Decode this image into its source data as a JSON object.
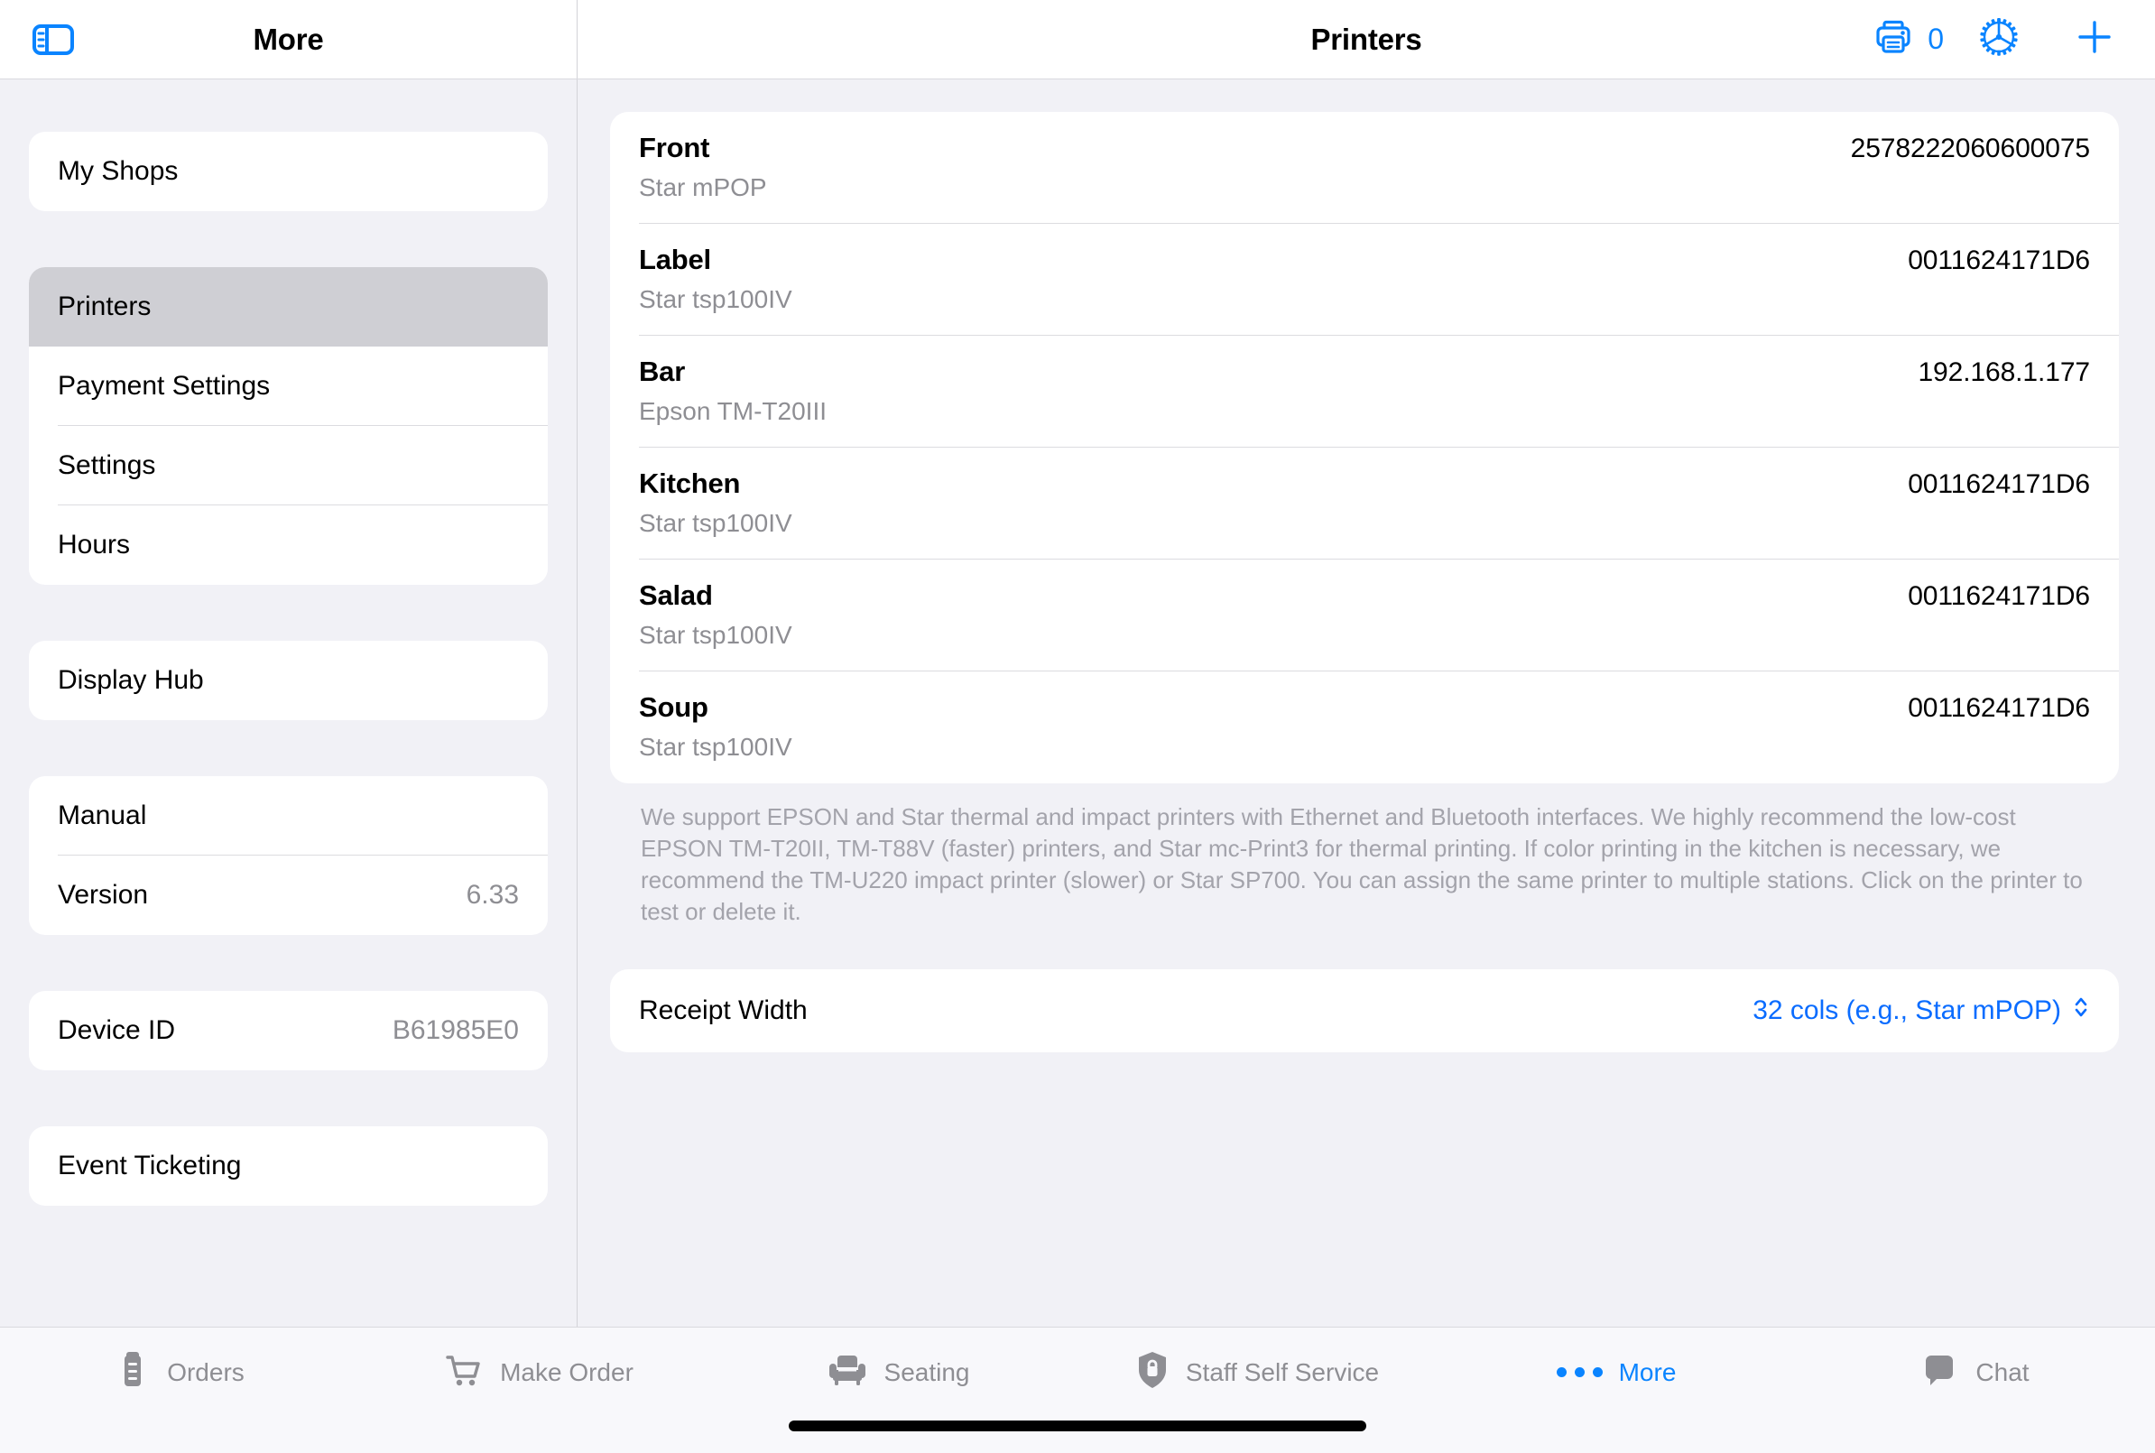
{
  "topbar": {
    "sidebar_toggle_icon": "sidebar-icon",
    "left_title": "More",
    "right_title": "Printers",
    "print_queue_icon": "printer-icon",
    "print_queue_count": "0",
    "settings_icon": "gear-icon",
    "add_icon": "plus-icon",
    "accent_color": "#0a84ff"
  },
  "sidebar": {
    "group1": [
      {
        "label": "My Shops",
        "value": "",
        "selected": false
      }
    ],
    "group2": [
      {
        "label": "Printers",
        "value": "",
        "selected": true
      },
      {
        "label": "Payment Settings",
        "value": "",
        "selected": false
      },
      {
        "label": "Settings",
        "value": "",
        "selected": false
      },
      {
        "label": "Hours",
        "value": "",
        "selected": false
      }
    ],
    "group3": [
      {
        "label": "Display Hub",
        "value": "",
        "selected": false
      }
    ],
    "group4": [
      {
        "label": "Manual",
        "value": "",
        "selected": false
      },
      {
        "label": "Version",
        "value": "6.33",
        "selected": false
      }
    ],
    "group5": [
      {
        "label": "Device ID",
        "value": "B61985E0",
        "selected": false
      }
    ],
    "group6": [
      {
        "label": "Event Ticketing",
        "value": "",
        "selected": false
      }
    ]
  },
  "main": {
    "printers": [
      {
        "name": "Front",
        "id": "2578222060600075",
        "model": "Star mPOP"
      },
      {
        "name": "Label",
        "id": "0011624171D6",
        "model": "Star tsp100IV"
      },
      {
        "name": "Bar",
        "id": "192.168.1.177",
        "model": "Epson TM-T20III"
      },
      {
        "name": "Kitchen",
        "id": "0011624171D6",
        "model": "Star tsp100IV"
      },
      {
        "name": "Salad",
        "id": "0011624171D6",
        "model": "Star tsp100IV"
      },
      {
        "name": "Soup",
        "id": "0011624171D6",
        "model": "Star tsp100IV"
      }
    ],
    "help_text": "We support EPSON and Star thermal and impact printers with Ethernet and Bluetooth interfaces. We highly recommend the low-cost EPSON TM-T20II, TM-T88V (faster) printers, and Star mc-Print3 for thermal printing. If color printing in the kitchen is necessary, we recommend the TM-U220 impact printer (slower) or Star SP700. You can assign the same printer to multiple stations. Click on the printer to test or delete it.",
    "receipt_width": {
      "label": "Receipt Width",
      "value": "32 cols (e.g., Star mPOP)",
      "stepper_icon": "chevron-up-down-icon"
    }
  },
  "tabbar": {
    "tabs": [
      {
        "label": "Orders",
        "icon": "clipboard-icon",
        "active": false
      },
      {
        "label": "Make Order",
        "icon": "cart-icon",
        "active": false
      },
      {
        "label": "Seating",
        "icon": "armchair-icon",
        "active": false
      },
      {
        "label": "Staff Self Service",
        "icon": "shield-lock-icon",
        "active": false
      },
      {
        "label": "More",
        "icon": "ellipsis-icon",
        "active": true
      },
      {
        "label": "Chat",
        "icon": "chat-bubble-icon",
        "active": false
      }
    ]
  }
}
